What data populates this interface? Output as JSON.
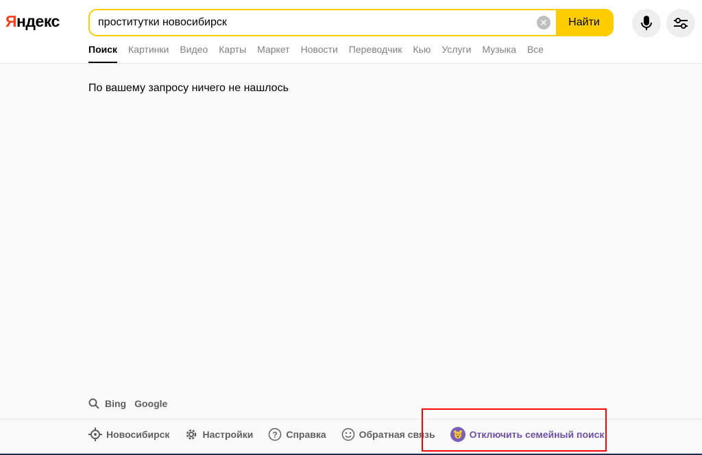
{
  "header": {
    "logo_first": "Я",
    "logo_rest": "ндекс",
    "search": {
      "value": "проститутки новосибирск",
      "placeholder": ""
    },
    "find_label": "Найти"
  },
  "tabs": [
    {
      "label": "Поиск",
      "active": true
    },
    {
      "label": "Картинки"
    },
    {
      "label": "Видео"
    },
    {
      "label": "Карты"
    },
    {
      "label": "Маркет"
    },
    {
      "label": "Новости"
    },
    {
      "label": "Переводчик"
    },
    {
      "label": "Кью"
    },
    {
      "label": "Услуги"
    },
    {
      "label": "Музыка"
    },
    {
      "label": "Все"
    }
  ],
  "main": {
    "no_results": "По вашему запросу ничего не нашлось"
  },
  "other_engines": {
    "bing": "Bing",
    "google": "Google"
  },
  "footer": {
    "region": "Новосибирск",
    "settings": "Настройки",
    "help": "Справка",
    "feedback": "Обратная связь",
    "family": "Отключить семейный поиск"
  },
  "colors": {
    "accent": "#ffcc00",
    "logo_red": "#fc3f1d",
    "family_purple": "#6d4fa6",
    "highlight": "#ff0000"
  },
  "icons": [
    "clear-icon",
    "microphone-icon",
    "filters-icon",
    "search-icon",
    "location-icon",
    "gear-icon",
    "help-icon",
    "smile-icon",
    "bear-icon"
  ]
}
